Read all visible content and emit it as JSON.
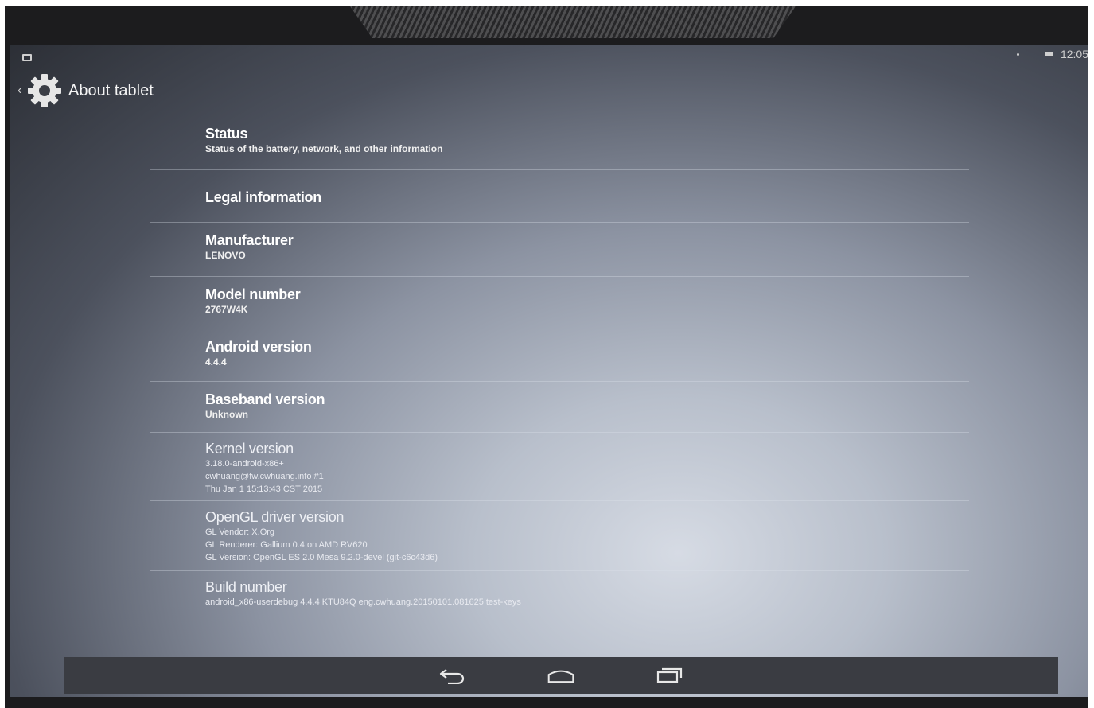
{
  "status_bar": {
    "clock": "12:05"
  },
  "action_bar": {
    "title": "About tablet",
    "icon": "settings-gear-icon"
  },
  "items": [
    {
      "title": "Status",
      "summary": "Status of the battery, network, and other information"
    },
    {
      "title": "Legal information",
      "summary": ""
    },
    {
      "title": "Manufacturer",
      "summary": "LENOVO"
    },
    {
      "title": "Model number",
      "summary": "2767W4K"
    },
    {
      "title": "Android version",
      "summary": "4.4.4"
    },
    {
      "title": "Baseband version",
      "summary": "Unknown"
    },
    {
      "title": "Kernel version",
      "summary": "3.18.0-android-x86+\ncwhuang@fw.cwhuang.info #1\nThu Jan 1 15:13:43 CST 2015"
    },
    {
      "title": "OpenGL driver version",
      "summary": "GL Vendor: X.Org\nGL Renderer: Gallium 0.4 on AMD RV620\nGL Version: OpenGL ES 2.0 Mesa 9.2.0-devel (git-c6c43d6)"
    },
    {
      "title": "Build number",
      "summary": "android_x86-userdebug 4.4.4 KTU84Q eng.cwhuang.20150101.081625 test-keys"
    }
  ],
  "nav_bar": {
    "back": "back-icon",
    "home": "home-icon",
    "recents": "recents-icon"
  }
}
